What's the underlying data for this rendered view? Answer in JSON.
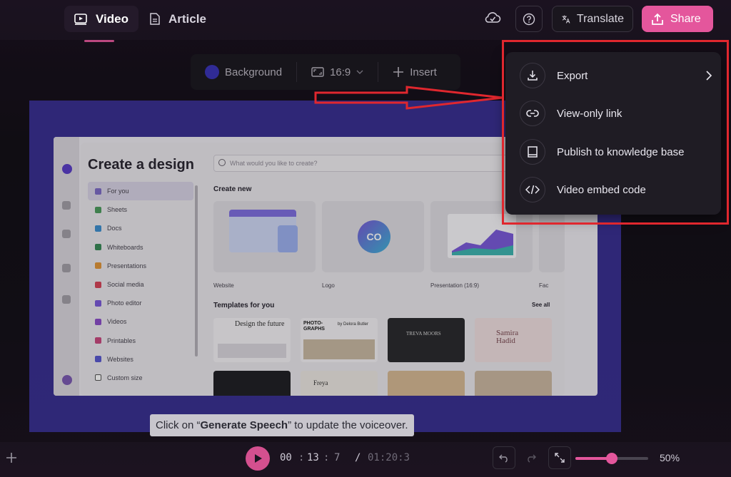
{
  "tabs": [
    {
      "label": "Video",
      "active": true
    },
    {
      "label": "Article",
      "active": false
    }
  ],
  "header": {
    "translate_label": "Translate",
    "share_label": "Share",
    "accent": "#e4569c"
  },
  "toolbar": {
    "background_label": "Background",
    "aspect_label": "16:9",
    "insert_label": "Insert",
    "background_color": "#3b35b8"
  },
  "share_menu": {
    "items": [
      {
        "label": "Export",
        "icon": "download-icon",
        "has_submenu": true
      },
      {
        "label": "View-only link",
        "icon": "link-icon",
        "has_submenu": false
      },
      {
        "label": "Publish to knowledge base",
        "icon": "book-icon",
        "has_submenu": false
      },
      {
        "label": "Video embed code",
        "icon": "code-icon",
        "has_submenu": false
      }
    ]
  },
  "screenshot": {
    "modal_title": "Create a design",
    "search_placeholder": "What would you like to create?",
    "nav": [
      "For you",
      "Sheets",
      "Docs",
      "Whiteboards",
      "Presentations",
      "Social media",
      "Photo editor",
      "Videos",
      "Printables",
      "Websites",
      "Custom size"
    ],
    "create_new_heading": "Create new",
    "create_cards": [
      "Website",
      "Logo",
      "Presentation (16:9)",
      "Fac"
    ],
    "templates_heading": "Templates for you",
    "see_all": "See all",
    "logo_text": "CO",
    "template_texts": [
      "Design the future",
      "PHOTO-GRAPHS",
      "by Delora Butler",
      "TREVA MOORS",
      "Samira Hadid",
      "Freya"
    ]
  },
  "caption": {
    "prefix": "Click on “",
    "bold": "Generate Speech",
    "suffix": "” to update the voiceover."
  },
  "player": {
    "current_min": "00",
    "current_sec": "13",
    "current_frac": "7",
    "separator": "/",
    "total": "01:20:3",
    "zoom": "50%",
    "zoom_fraction": 0.5
  }
}
